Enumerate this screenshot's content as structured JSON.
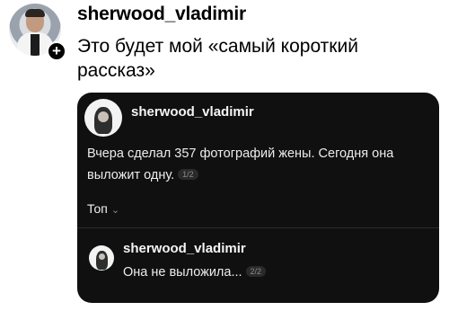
{
  "post": {
    "username": "sherwood_vladimir",
    "text": "Это будет мой «самый короткий рассказ»",
    "follow_symbol": "+"
  },
  "quoted": {
    "username": "sherwood_vladimir",
    "text": "Вчера сделал 357 фотографий жены. Сегодня она выложит одну.",
    "counter": "1/2",
    "sort_label": "Топ",
    "sort_chevron": "⌄",
    "reply": {
      "username": "sherwood_vladimir",
      "text": "Она не выложила...",
      "counter": "2/2"
    }
  },
  "icons": {
    "follow": "plus-icon",
    "sort": "chevron-down-icon"
  }
}
